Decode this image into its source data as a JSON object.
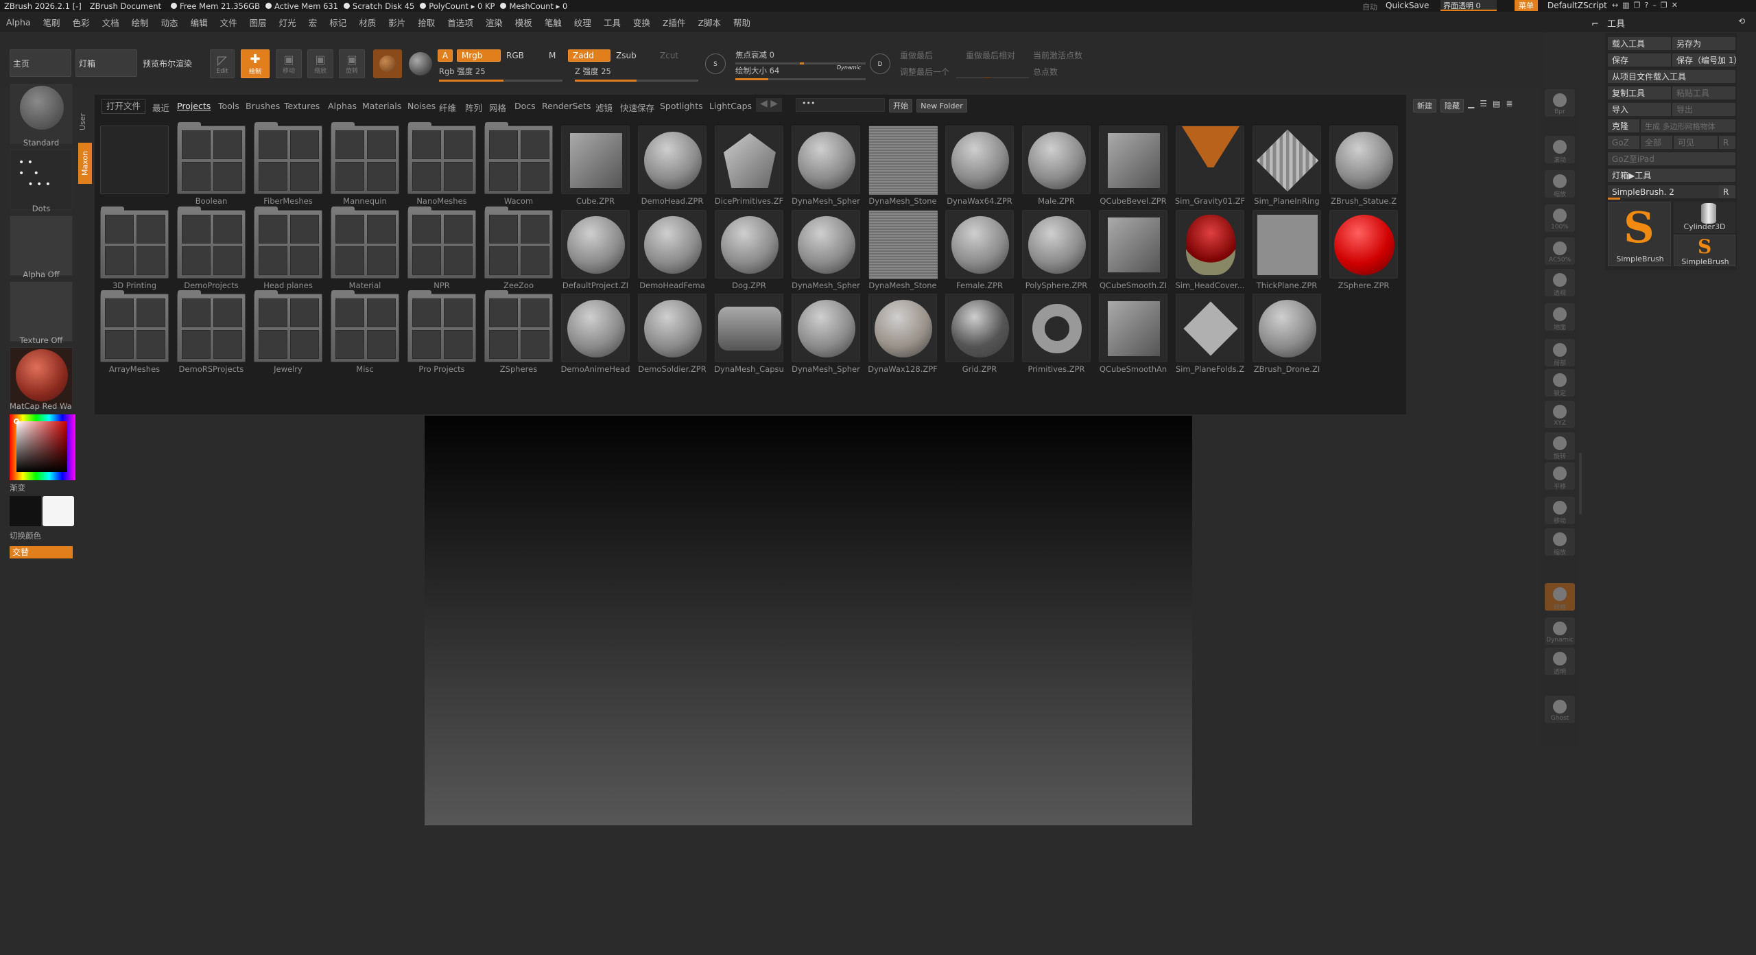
{
  "titlebar": {
    "app": "ZBrush 2026.2.1 [-]",
    "doc": "ZBrush Document",
    "free_mem": "Free Mem 21.356GB",
    "active_mem": "Active Mem 631",
    "scratch": "Scratch Disk 45",
    "polycount": "PolyCount ▸ 0 KP",
    "meshcount": "MeshCount ▸ 0",
    "auto": "自动",
    "quicksave": "QuickSave",
    "transparency": "界面透明 0",
    "menus_btn": "菜单",
    "zscript": "DefaultZScript"
  },
  "menubar": [
    "Alpha",
    "笔刷",
    "色彩",
    "文档",
    "绘制",
    "动态",
    "编辑",
    "文件",
    "图层",
    "灯光",
    "宏",
    "标记",
    "材质",
    "影片",
    "拾取",
    "首选项",
    "渲染",
    "模板",
    "笔触",
    "纹理",
    "工具",
    "变换",
    "Z插件",
    "Z脚本",
    "帮助"
  ],
  "toolbar": {
    "home": "主页",
    "lightbox": "灯箱",
    "preview_render": "预览布尔渲染",
    "edit": "Edit",
    "draw": "绘制",
    "move": "移动",
    "scale": "缩放",
    "rotate": "旋转",
    "a": "A",
    "mrgb": "Mrgb",
    "rgb": "RGB",
    "m": "M",
    "zadd": "Zadd",
    "zsub": "Zsub",
    "zcut": "Zcut",
    "rgb_intensity": "Rgb 强度 25",
    "z_intensity": "Z 强度 25",
    "focal_shift": "焦点衰减 0",
    "draw_size": "绘制大小 64",
    "dynamic": "Dynamic",
    "replay_last": "重做最后",
    "replay_last_rel": "重做最后相对",
    "active_points": "当前激活点数",
    "adjust_last": "调整最后一个",
    "total_points": "总点数"
  },
  "left_tray": {
    "brush": "Standard",
    "stroke": "Dots",
    "alpha": "Alpha Off",
    "texture": "Texture Off",
    "material": "MatCap Red Wa",
    "gradient": "渐变",
    "switch_color": "切换颜色",
    "alternate": "交替",
    "color_main": "#111111",
    "color_secondary": "#f5f5f5"
  },
  "browser": {
    "side_tabs": [
      "User",
      "Maxon"
    ],
    "nav": [
      "打开文件",
      "最近",
      "Projects",
      "Tools",
      "Brushes",
      "Textures",
      "Alphas",
      "Materials",
      "Noises",
      "纤维",
      "阵列",
      "网格",
      "Docs",
      "RenderSets",
      "滤镜",
      "快速保存",
      "Spotlights",
      "LightCaps"
    ],
    "active_nav": "Projects",
    "start": "开始",
    "new_folder": "New Folder",
    "new": "新建",
    "hide": "隐藏",
    "rows": [
      [
        "",
        "Boolean",
        "FiberMeshes",
        "Mannequin",
        "NanoMeshes",
        "Wacom",
        "Cube.ZPR",
        "DemoHead.ZPR",
        "DicePrimitives.ZF",
        "DynaMesh_Spher",
        "DynaMesh_Stone",
        "DynaWax64.ZPR",
        "Male.ZPR",
        "QCubeBevel.ZPR",
        "Sim_Gravity01.ZF",
        "Sim_PlaneInRing",
        "ZBrush_Statue.Z"
      ],
      [
        "3D Printing",
        "DemoProjects",
        "Head planes",
        "Material",
        "NPR",
        "ZeeZoo",
        "DefaultProject.ZI",
        "DemoHeadFema",
        "Dog.ZPR",
        "DynaMesh_Spher",
        "DynaMesh_Stone",
        "Female.ZPR",
        "PolySphere.ZPR",
        "QCubeSmooth.ZI",
        "Sim_HeadCover...",
        "ThickPlane.ZPR",
        "ZSphere.ZPR"
      ],
      [
        "ArrayMeshes",
        "DemoRSProjects",
        "Jewelry",
        "Misc",
        "Pro Projects",
        "ZSpheres",
        "DemoAnimeHead",
        "DemoSoldier.ZPR",
        "DynaMesh_Capsu",
        "DynaMesh_Spher",
        "DynaWax128.ZPF",
        "Grid.ZPR",
        "Primitives.ZPR",
        "QCubeSmoothAn",
        "Sim_PlaneFolds.Z",
        "ZBrush_Drone.ZI"
      ]
    ]
  },
  "right_shelf": [
    "Bpr",
    "滚动",
    "缩放",
    "100%",
    "AC50%",
    "透视",
    "地面",
    "局部",
    "锁定",
    "XYZ",
    "旋转",
    "平移",
    "移动",
    "缩放",
    "线框",
    "Dynamic",
    "透明",
    "Ghost"
  ],
  "tool_panel": {
    "title": "工具",
    "load_tool": "载入工具",
    "save_as": "另存为",
    "save": "保存",
    "save_inc": "保存（编号加 1）",
    "load_from_project": "从项目文件载入工具",
    "copy_tool": "复制工具",
    "paste_tool": "粘贴工具",
    "import": "导入",
    "export": "导出",
    "clone": "克隆",
    "make_polymesh": "生成 多边形网格物体",
    "goz": "GoZ",
    "all": "全部",
    "visible": "可见",
    "r": "R",
    "goz_ipad": "GoZ至iPad",
    "lightbox_tools": "灯箱▶工具",
    "current_tool": "SimpleBrush. 2",
    "tools": [
      "SimpleBrush",
      "Cylinder3D",
      "SimpleBrush"
    ]
  }
}
